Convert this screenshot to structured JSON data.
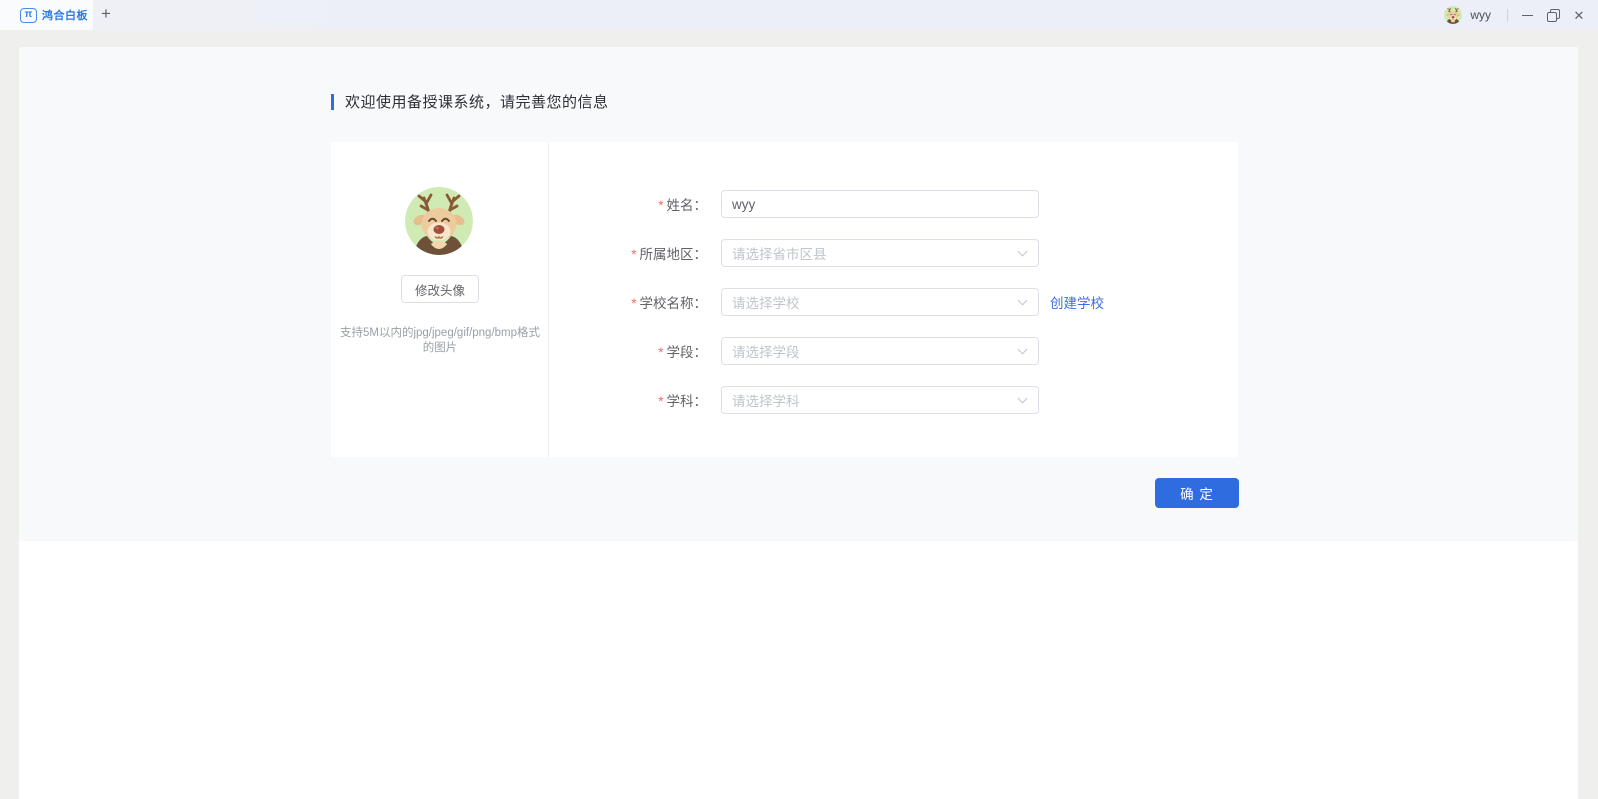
{
  "titlebar": {
    "tab_title": "鸿合白板",
    "logo_glyph": "π",
    "icons": {
      "new_tab": "+",
      "close": "✕"
    },
    "user_name": "wyy"
  },
  "page": {
    "heading": "欢迎使用备授课系统，请完善您的信息",
    "avatar_panel": {
      "change_button": "修改头像",
      "hint_line1": "支持5M以内的jpg/jpeg/gif/png/bmp格式",
      "hint_line2": "的图片"
    },
    "form": {
      "required_marker": "*",
      "fields": [
        {
          "label": "姓名：",
          "type": "text",
          "value": "wyy"
        },
        {
          "label": "所属地区：",
          "type": "select",
          "placeholder": "请选择省市区县"
        },
        {
          "label": "学校名称：",
          "type": "select",
          "placeholder": "请选择学校",
          "action_link": "创建学校"
        },
        {
          "label": "学段：",
          "type": "select",
          "placeholder": "请选择学段"
        },
        {
          "label": "学科：",
          "type": "select",
          "placeholder": "请选择学科"
        }
      ],
      "submit_button": "确 定"
    },
    "colors": {
      "primary": "#2F6CE0",
      "link": "#3B6FE0",
      "required": "#F56C6C",
      "tab_text": "#2B7BE4",
      "avatar_bg": "#CFEAB3"
    }
  }
}
